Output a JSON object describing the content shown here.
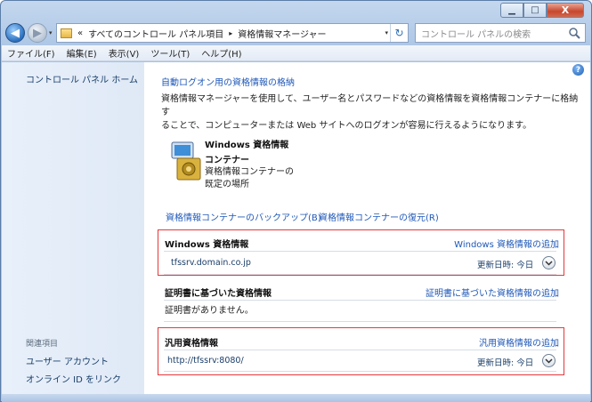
{
  "window": {
    "controls": {
      "minimize": "▁",
      "maximize": "□",
      "close": "X"
    }
  },
  "nav": {
    "back": "◀",
    "forward": "▶",
    "history": "▾"
  },
  "address": {
    "chevron": "«",
    "crumbs": [
      "すべてのコントロール パネル項目",
      "資格情報マネージャー"
    ],
    "separator": "▸",
    "dropdown": "▾",
    "refresh": "↻"
  },
  "search": {
    "placeholder": "コントロール パネルの検索"
  },
  "menu": {
    "items": [
      "ファイル(F)",
      "編集(E)",
      "表示(V)",
      "ツール(T)",
      "ヘルプ(H)"
    ]
  },
  "sidebar": {
    "home": "コントロール パネル ホーム",
    "related_heading": "関連項目",
    "links": [
      "ユーザー アカウント",
      "オンライン ID をリンク"
    ]
  },
  "main": {
    "help": "?",
    "autologon_link": "自動ログオン用の資格情報の格納",
    "description_line1": "資格情報マネージャーを使用して、ユーザー名とパスワードなどの資格情報を資格情報コンテナーに格納す",
    "description_line2": "ることで、コンピューターまたは Web サイトへのログオンが容易に行えるようになります。",
    "vault": {
      "title_line1": "Windows 資格情報",
      "title_line2": "コンテナー",
      "sub_line1": "資格情報コンテナーの",
      "sub_line2": "既定の場所"
    },
    "backup_link": "資格情報コンテナーのバックアップ(B)",
    "restore_link": "資格情報コンテナーの復元(R)",
    "sections": {
      "windows": {
        "title": "Windows 資格情報",
        "add_link": "Windows 資格情報の追加",
        "entry": "tfssrv.domain.co.jp",
        "modified": "更新日時:  今日"
      },
      "certificate": {
        "title": "証明書に基づいた資格情報",
        "add_link": "証明書に基づいた資格情報の追加",
        "empty": "証明書がありません。"
      },
      "generic": {
        "title": "汎用資格情報",
        "add_link": "汎用資格情報の追加",
        "entry": "http://tfssrv:8080/",
        "modified": "更新日時:  今日"
      }
    }
  }
}
